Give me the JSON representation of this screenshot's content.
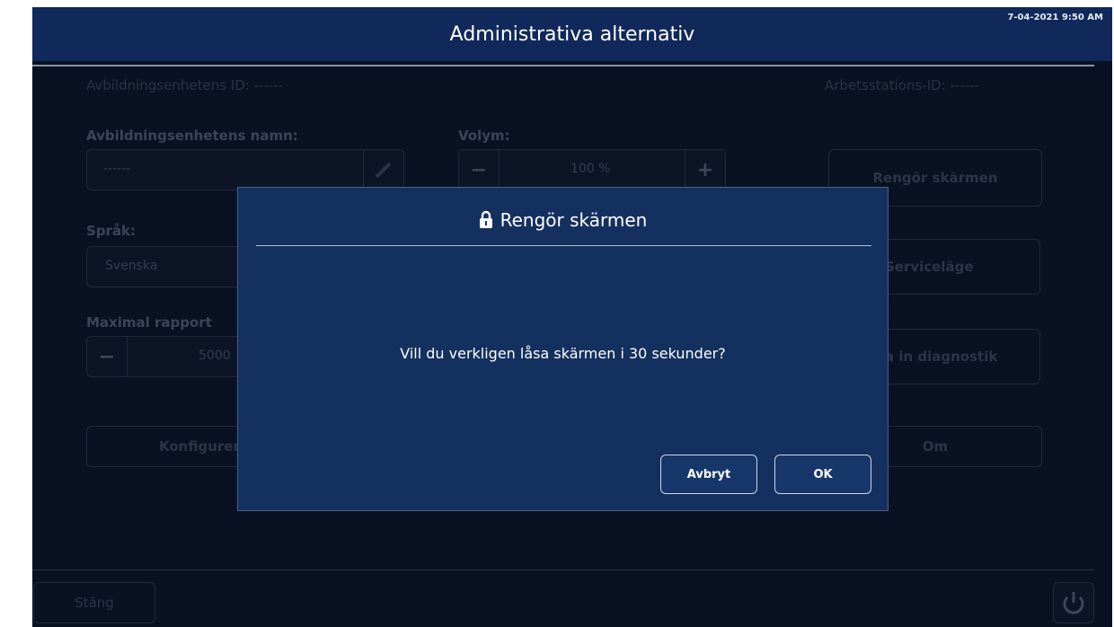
{
  "header": {
    "title": "Administrativa alternativ",
    "timestamp": "7-04-2021 9:50 AM"
  },
  "background": {
    "device_id_label": "Avbildningsenhetens ID: ------",
    "workstation_id_label": "Arbetsstations-ID: ------",
    "device_name_label": "Avbildningsenhetens namn:",
    "device_name_value": "------",
    "volume_label": "Volym:",
    "volume_value": "100 %",
    "language_label": "Språk:",
    "language_value": "Svenska",
    "max_report_label": "Maximal rapport",
    "max_report_value": "5000",
    "configure_label": "Konfigurera",
    "clean_screen_label": "Rengör skärmen",
    "service_mode_label": "Serviceläge",
    "diagnostics_label": "a in diagnostik",
    "about_label": "Om",
    "close_label": "Stäng"
  },
  "dialog": {
    "title": "Rengör skärmen",
    "message": "Vill du verkligen låsa skärmen i 30 sekunder?",
    "cancel_label": "Avbryt",
    "ok_label": "OK"
  },
  "icons": {
    "title_icon": "lock-icon",
    "edit_icon": "pencil-icon",
    "power_icon": "power-icon"
  },
  "colors": {
    "header_bg": "#10295a",
    "dialog_bg": "#14305f",
    "screen_bg": "#0a1122"
  }
}
